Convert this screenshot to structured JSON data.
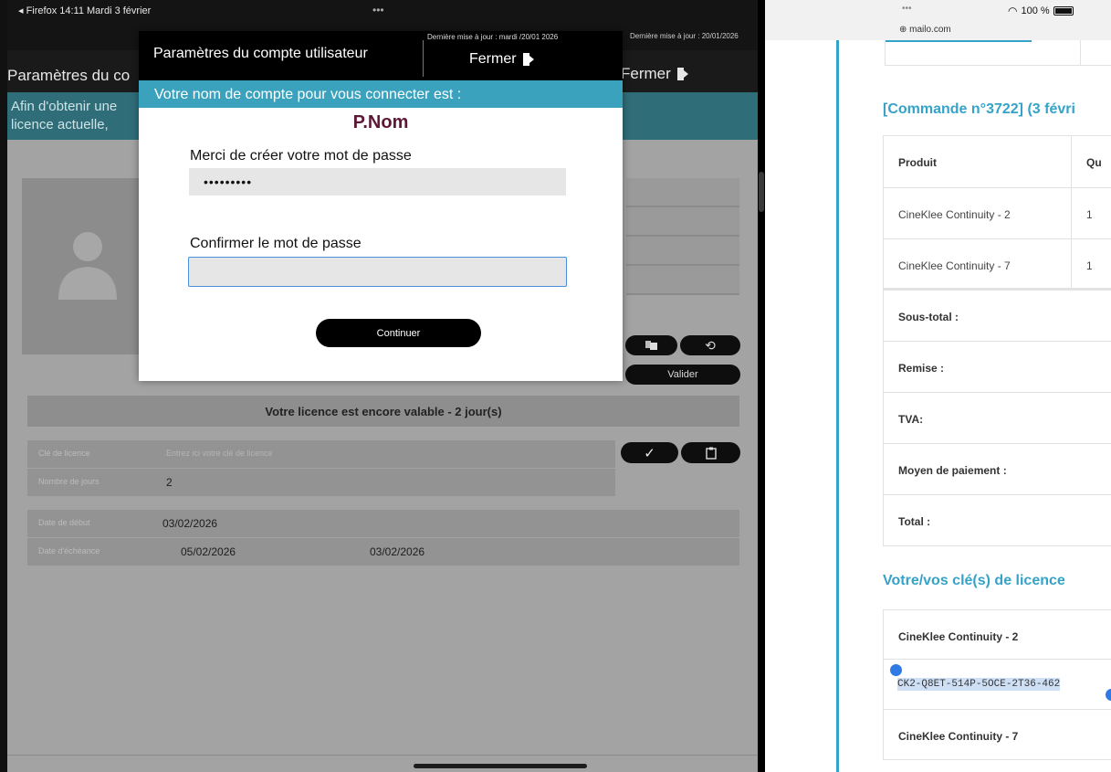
{
  "left_app": {
    "status_bar": {
      "text": "◂ Firefox  14:11   Mardi 3 février",
      "dots": "•••",
      "update_text": "Dernière mise à jour : 20/01/2026"
    },
    "title": "Paramètres du co",
    "close_label": "Fermer",
    "info_lines": [
      "Afin d'obtenir une",
      "licence actuelle, "
    ],
    "buttons": {
      "validate": "Valider",
      "copy_icon": "copy-icon",
      "refresh_icon": "refresh-icon",
      "check_icon": "check-icon",
      "paste_icon": "clipboard-icon"
    },
    "license_banner": "Votre licence est encore valable - 2 jour(s)",
    "rows": {
      "license_key_label": "Clé de licence",
      "license_key_placeholder": "Entrez ici votre clé de licence",
      "days_label": "Nombre de jours",
      "days_value": "2",
      "start_label": "Date de début",
      "start_value": "03/02/2026",
      "end_label": "Date d'échéance",
      "end_value": "05/02/2026",
      "end_value2": "03/02/2026"
    }
  },
  "modal": {
    "title": "Paramètres du compte utilisateur",
    "update_text": "Dernière mise à jour : mardi /20/01 2026",
    "close_label": "Fermer",
    "subtitle": "Votre nom de compte pour vous connecter est :",
    "username": "P.Nom",
    "password_label": "Merci de créer votre mot de passe",
    "password_value": "•••••••••",
    "confirm_label": "Confirmer le mot de passe",
    "confirm_value": "",
    "continue_label": "Continuer"
  },
  "right_mail": {
    "status": {
      "dots": "•••",
      "host": "⊕ mailo.com",
      "battery": "100 %"
    },
    "order_title": "[Commande n°3722] (3 févri",
    "order_header": {
      "product": "Produit",
      "qty": "Qu"
    },
    "order_rows": [
      {
        "product": "CineKlee Continuity - 2",
        "qty": "1"
      },
      {
        "product": "CineKlee Continuity - 7",
        "qty": "1"
      }
    ],
    "totals": [
      "Sous-total :",
      "Remise :",
      "TVA:",
      "Moyen de paiement :",
      "Total :"
    ],
    "license_title": "Votre/vos clé(s) de licence",
    "license_rows": [
      {
        "name": "CineKlee Continuity - 2",
        "key": "CK2-Q8ET-514P-5OCE-2T36-462"
      },
      {
        "name": "CineKlee Continuity - 7"
      }
    ]
  }
}
